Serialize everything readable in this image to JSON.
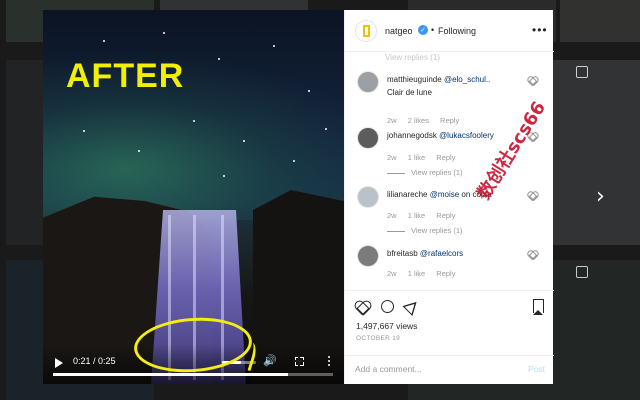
{
  "overlay_label": "AFTER",
  "watermark": "数创社scs66",
  "video": {
    "current_time": "0:21",
    "duration": "0:25",
    "time_display": "0:21 / 0:25",
    "progress": 0.84,
    "volume": 0.55,
    "annotation_color": "#f3ee12"
  },
  "header": {
    "username": "natgeo",
    "verified_mark": "✓",
    "separator": "•",
    "follow_status": "Following",
    "more": "•••"
  },
  "comments": [
    {
      "user": "matthieuguinde",
      "mention": "@elo_schul..",
      "text": "Clair de lune",
      "time": "2w",
      "likes": "2 likes",
      "reply": "Reply",
      "view_replies": ""
    },
    {
      "user": "johannegodsk",
      "mention": "@lukacsfoolery",
      "text": "",
      "time": "2w",
      "likes": "1 like",
      "reply": "Reply",
      "view_replies": "View replies (1)"
    },
    {
      "user": "lilianareche",
      "mention": "@moise",
      "text": "on copia",
      "time": "2w",
      "likes": "1 like",
      "reply": "Reply",
      "view_replies": "View replies (1)"
    },
    {
      "user": "bfreitasb",
      "mention": "@rafaelcors",
      "text": "",
      "time": "2w",
      "likes": "1 like",
      "reply": "Reply",
      "view_replies": ""
    }
  ],
  "stats": {
    "views": "1,497,667 views",
    "date": "OCTOBER 19"
  },
  "add_comment": {
    "placeholder": "Add a comment...",
    "post_label": "Post"
  },
  "colors": {
    "overlay_text": "#f0f000",
    "link": "#003569",
    "verified": "#3897f0",
    "watermark": "#c8102e"
  },
  "icons": {
    "next": "chevron-right-icon",
    "play": "play-icon",
    "volume": "volume-icon",
    "fullscreen": "fullscreen-icon",
    "more": "more-vertical-icon",
    "like": "heart-icon",
    "comment": "comment-icon",
    "share": "share-icon",
    "save": "bookmark-icon"
  }
}
